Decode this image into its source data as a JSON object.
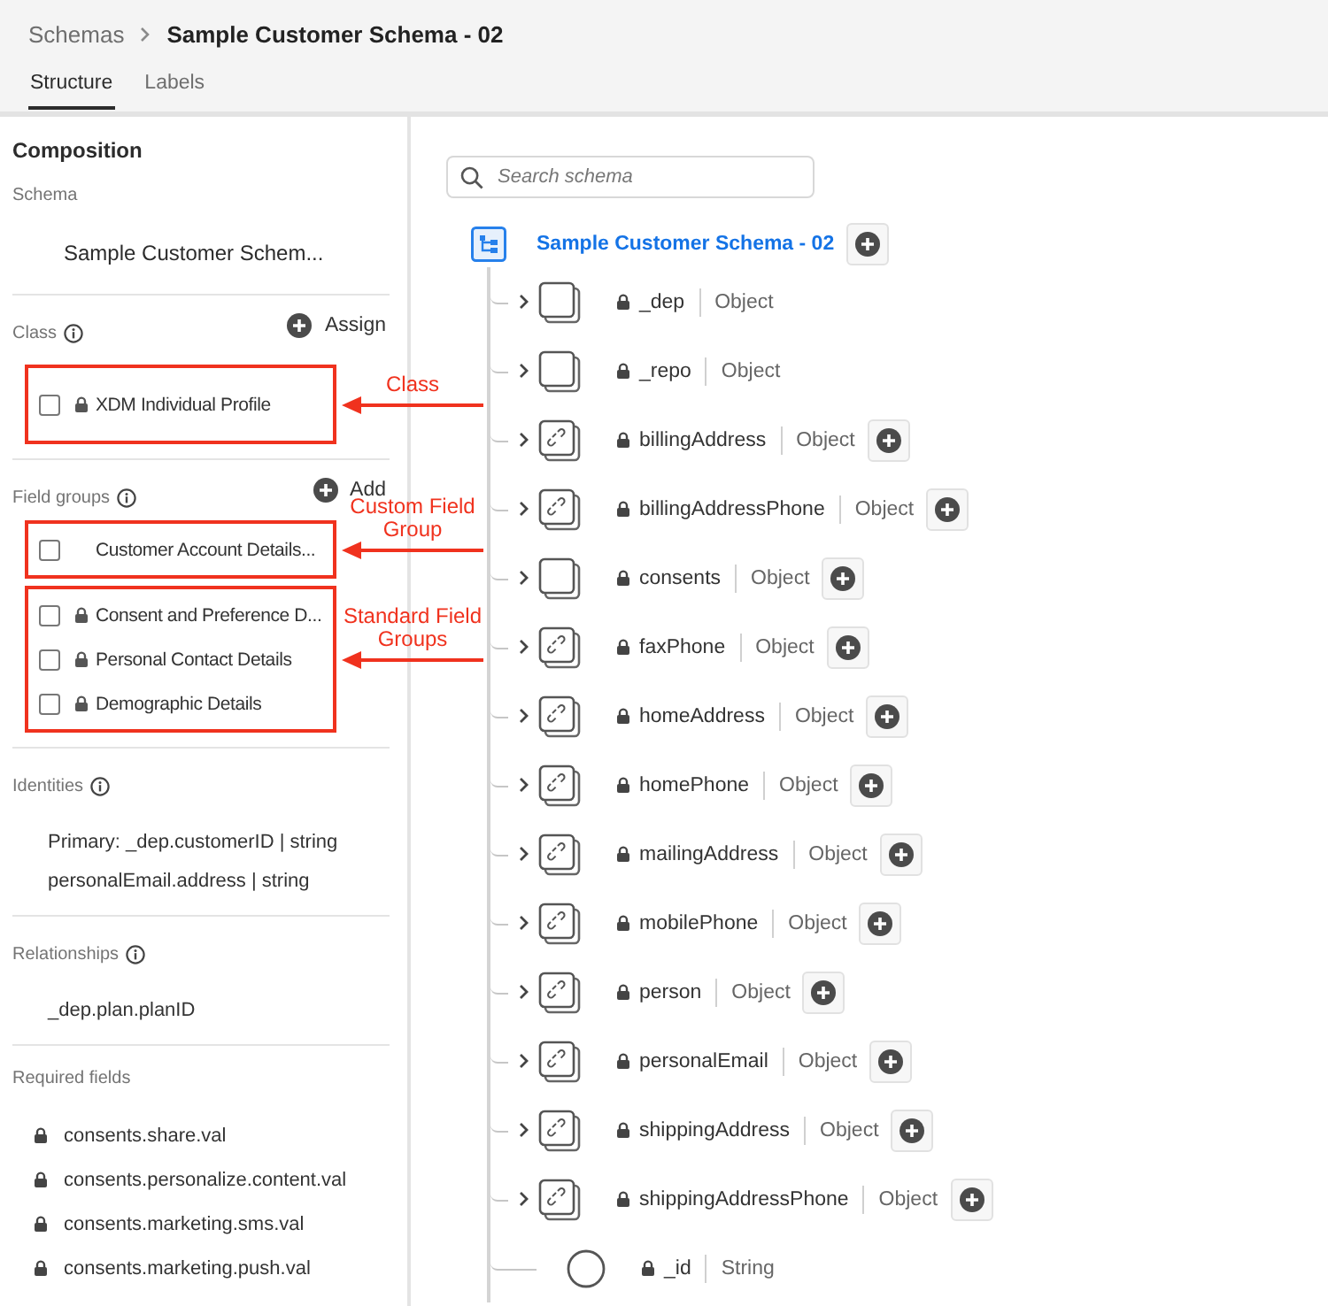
{
  "breadcrumb": {
    "parent": "Schemas",
    "title": "Sample Customer Schema - 02"
  },
  "tabs": [
    {
      "label": "Structure",
      "selected": true
    },
    {
      "label": "Labels",
      "selected": false
    }
  ],
  "composition": {
    "title": "Composition",
    "schema": {
      "heading": "Schema",
      "name": "Sample Customer Schem..."
    },
    "class": {
      "heading": "Class",
      "action": "Assign",
      "callout": "Class",
      "items": [
        {
          "label": "XDM Individual Profile",
          "checked": false,
          "locked": true
        }
      ]
    },
    "field_groups": {
      "heading": "Field groups",
      "action": "Add",
      "groups": [
        {
          "callout": "Custom Field Group",
          "items": [
            {
              "label": "Customer Account Details...",
              "checked": false,
              "locked": false
            }
          ]
        },
        {
          "callout": "Standard Field Groups",
          "items": [
            {
              "label": "Consent and Preference D...",
              "checked": false,
              "locked": true
            },
            {
              "label": "Personal Contact Details",
              "checked": false,
              "locked": true
            },
            {
              "label": "Demographic Details",
              "checked": false,
              "locked": true
            }
          ]
        }
      ]
    },
    "identities": {
      "heading": "Identities",
      "items": [
        "Primary: _dep.customerID | string",
        "personalEmail.address | string"
      ]
    },
    "relationships": {
      "heading": "Relationships",
      "items": [
        "_dep.plan.planID"
      ]
    },
    "required_fields": {
      "heading": "Required fields",
      "items": [
        "consents.share.val",
        "consents.personalize.content.val",
        "consents.marketing.sms.val",
        "consents.marketing.push.val"
      ]
    }
  },
  "search": {
    "placeholder": "Search schema"
  },
  "tree": {
    "root": "Sample Customer Schema - 02",
    "children": [
      {
        "name": "_dep",
        "type": "Object",
        "kind": "object",
        "addable": false
      },
      {
        "name": "_repo",
        "type": "Object",
        "kind": "object",
        "addable": false
      },
      {
        "name": "billingAddress",
        "type": "Object",
        "kind": "link",
        "addable": true
      },
      {
        "name": "billingAddressPhone",
        "type": "Object",
        "kind": "link",
        "addable": true
      },
      {
        "name": "consents",
        "type": "Object",
        "kind": "object",
        "addable": true
      },
      {
        "name": "faxPhone",
        "type": "Object",
        "kind": "link",
        "addable": true
      },
      {
        "name": "homeAddress",
        "type": "Object",
        "kind": "link",
        "addable": true
      },
      {
        "name": "homePhone",
        "type": "Object",
        "kind": "link",
        "addable": true
      },
      {
        "name": "mailingAddress",
        "type": "Object",
        "kind": "link",
        "addable": true
      },
      {
        "name": "mobilePhone",
        "type": "Object",
        "kind": "link",
        "addable": true
      },
      {
        "name": "person",
        "type": "Object",
        "kind": "link",
        "addable": true
      },
      {
        "name": "personalEmail",
        "type": "Object",
        "kind": "link",
        "addable": true
      },
      {
        "name": "shippingAddress",
        "type": "Object",
        "kind": "link",
        "addable": true
      },
      {
        "name": "shippingAddressPhone",
        "type": "Object",
        "kind": "link",
        "addable": true
      },
      {
        "name": "_id",
        "type": "String",
        "kind": "field",
        "addable": false
      }
    ]
  }
}
